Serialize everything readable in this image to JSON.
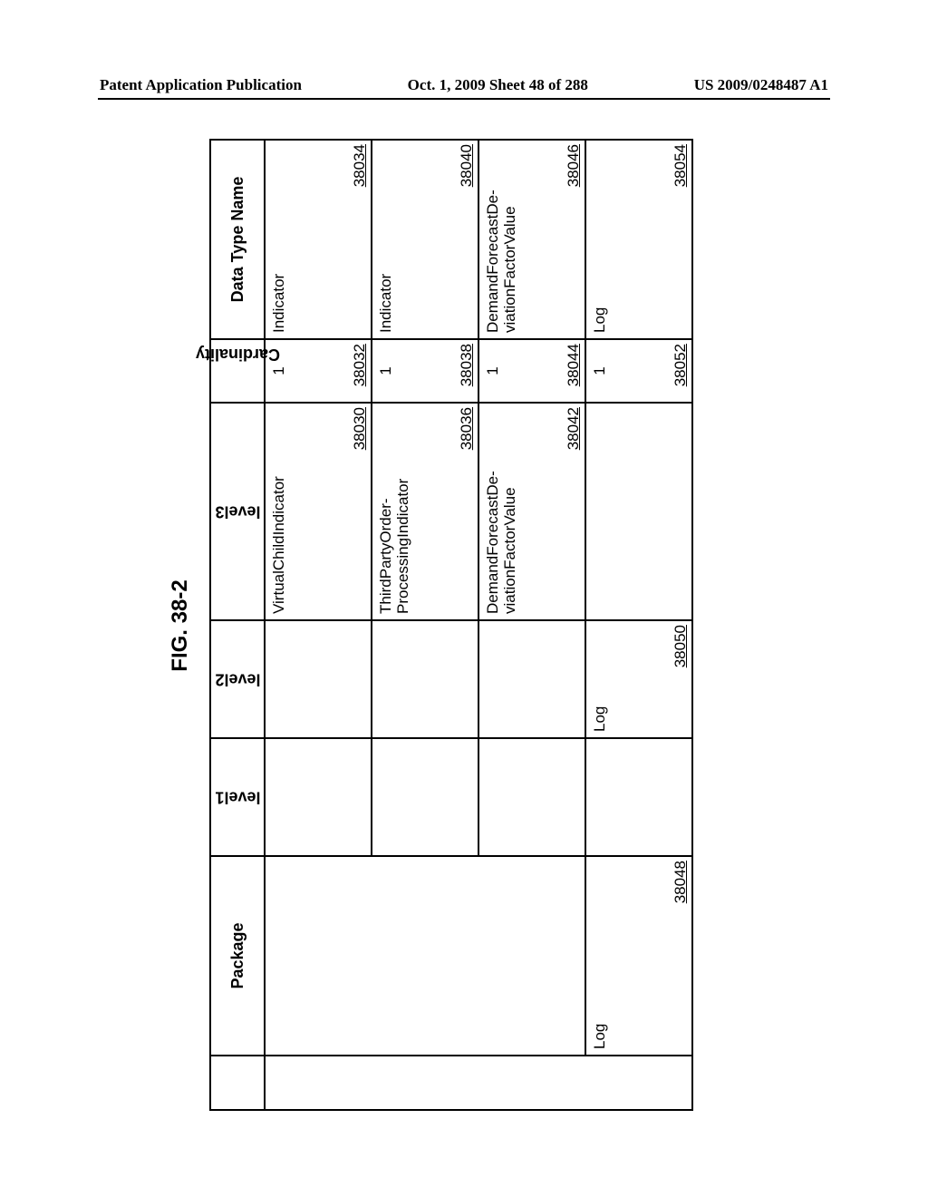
{
  "header": {
    "left": "Patent Application Publication",
    "center": "Oct. 1, 2009  Sheet 48 of 288",
    "right": "US 2009/0248487 A1"
  },
  "figure_label": "FIG. 38-2",
  "columns": {
    "blank": "",
    "package": "Package",
    "level1": "level1",
    "level2": "level2",
    "level3": "level3",
    "cardinality": "Cardinality",
    "datatype": "Data Type Name"
  },
  "rows": [
    {
      "package": "",
      "level1": "",
      "level2": "",
      "level3": "VirtualChildIndicator",
      "level3_ref": "38030",
      "cardinality": "1",
      "cardinality_ref": "38032",
      "datatype": "Indicator",
      "datatype_ref": "38034"
    },
    {
      "package": "",
      "level1": "",
      "level2": "",
      "level3": "ThirdPartyOrder-\nProcessingIndicator",
      "level3_ref": "38036",
      "cardinality": "1",
      "cardinality_ref": "38038",
      "datatype": "Indicator",
      "datatype_ref": "38040"
    },
    {
      "package": "",
      "level1": "",
      "level2": "",
      "level3": "DemandForecastDe-\nviationFactorValue",
      "level3_ref": "38042",
      "cardinality": "1",
      "cardinality_ref": "38044",
      "datatype": "DemandForecastDe-\nviationFactorValue",
      "datatype_ref": "38046"
    },
    {
      "package": "Log",
      "package_ref": "38048",
      "level1": "",
      "level2": "Log",
      "level2_ref": "38050",
      "level3": "",
      "cardinality": "1",
      "cardinality_ref": "38052",
      "datatype": "Log",
      "datatype_ref": "38054"
    }
  ]
}
